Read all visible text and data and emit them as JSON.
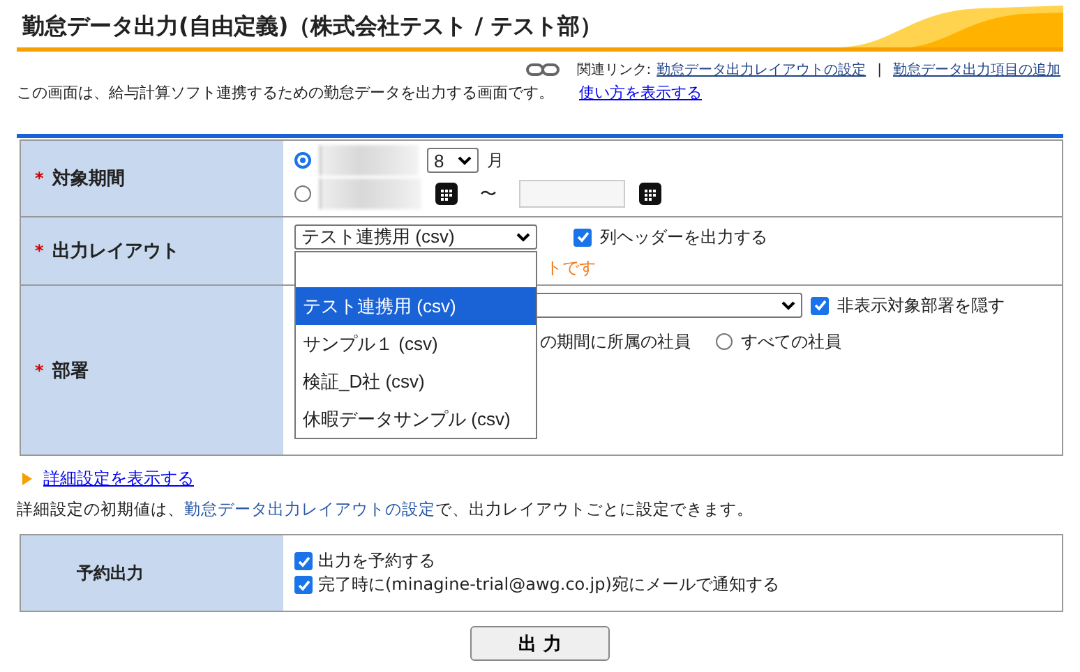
{
  "page_title": "勤怠データ出力(自由定義)（株式会社テスト / テスト部）",
  "related_links": {
    "label": "関連リンク:",
    "links": [
      "勤怠データ出力レイアウトの設定",
      "勤怠データ出力項目の追加"
    ],
    "separator": "|"
  },
  "description": "この画面は、給与計算ソフト連携するための勤怠データを出力する画面です。",
  "help_link": "使い方を表示する",
  "form": {
    "period": {
      "label": "対象期間",
      "required_mark": "*",
      "month_option": {
        "selected": true,
        "month": "8",
        "unit": "月"
      },
      "range_option": {
        "selected": false,
        "tilde": "〜"
      }
    },
    "layout": {
      "label": "出力レイアウト",
      "required_mark": "*",
      "select_value": "テスト連携用 (csv)",
      "header_checkbox": {
        "label": "列ヘッダーを出力する",
        "checked": true
      },
      "note_partial": "トです",
      "dropdown_options": [
        {
          "label": "テスト連携用 (csv)",
          "selected": true
        },
        {
          "label": "サンプル１ (csv)",
          "selected": false
        },
        {
          "label": "検証_D社 (csv)",
          "selected": false
        },
        {
          "label": "休暇データサンプル (csv)",
          "selected": false
        }
      ]
    },
    "department": {
      "label": "部署",
      "required_mark": "*",
      "hide_checkbox": {
        "label": "非表示対象部署を隠す",
        "checked": true
      },
      "partial_label": "の期間に所属の社員",
      "all_employees": {
        "label": "すべての社員",
        "selected": false
      }
    }
  },
  "details_link": "詳細設定を表示する",
  "details_note": {
    "before": "詳細設定の初期値は、",
    "link": "勤怠データ出力レイアウトの設定",
    "after": "で、出力レイアウトごとに設定できます。"
  },
  "reservation": {
    "label": "予約出力",
    "options": [
      {
        "label": "出力を予約する",
        "checked": true
      },
      {
        "label": "完了時に(minagine-trial@awg.co.jp)宛にメールで通知する",
        "checked": true
      }
    ]
  },
  "submit": "出 力"
}
